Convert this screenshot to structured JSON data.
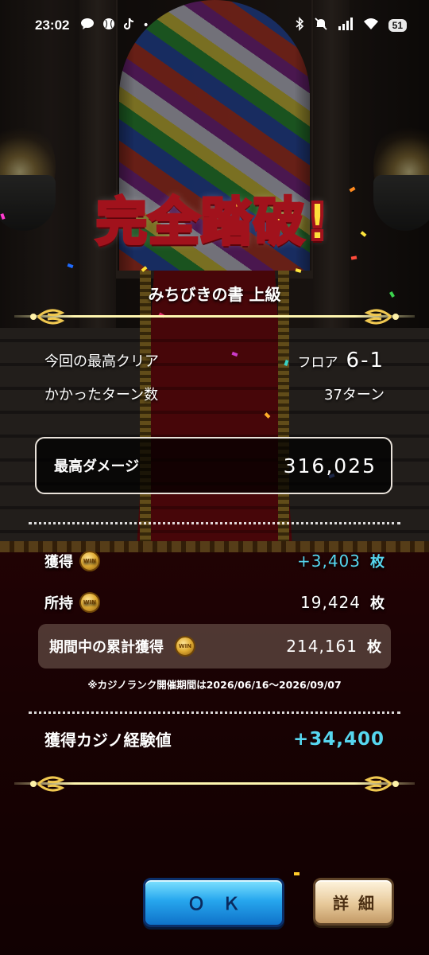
{
  "status_bar": {
    "time": "23:02",
    "left_icons": [
      "chat-bubble-icon",
      "baseball-icon",
      "tiktok-icon",
      "dot-icon"
    ],
    "right_icons": [
      "bluetooth-icon",
      "mute-icon",
      "signal-icon",
      "wifi-icon"
    ],
    "battery": "51"
  },
  "result": {
    "title": "完全踏破!",
    "quest_name": "みちびきの書 上級",
    "best_clear_label": "今回の最高クリア",
    "best_clear_prefix": "フロア",
    "best_clear_value": "6-1",
    "turns_label": "かかったターン数",
    "turns_value": "37ターン",
    "max_damage_label": "最高ダメージ",
    "max_damage_value": "316,025"
  },
  "coins": {
    "earned_label": "獲得",
    "earned_value": "+3,403",
    "earned_unit": "枚",
    "owned_label": "所持",
    "owned_value": "19,424",
    "owned_unit": "枚",
    "period_label": "期間中の累計獲得",
    "period_value": "214,161",
    "period_unit": "枚",
    "coin_text": "WIN",
    "note": "※カジノランク開催期間は2026/06/16〜2026/09/07"
  },
  "exp": {
    "label": "獲得カジノ経験値",
    "value": "+34,400"
  },
  "buttons": {
    "ok": "ＯＫ",
    "detail": "詳細"
  },
  "colors": {
    "accent_cyan": "#56d6ef",
    "title_gold": "#ffde3a",
    "title_stroke": "#a1121c",
    "ok_blue": "#27a7ee",
    "detail_beige": "#e7c99a"
  }
}
